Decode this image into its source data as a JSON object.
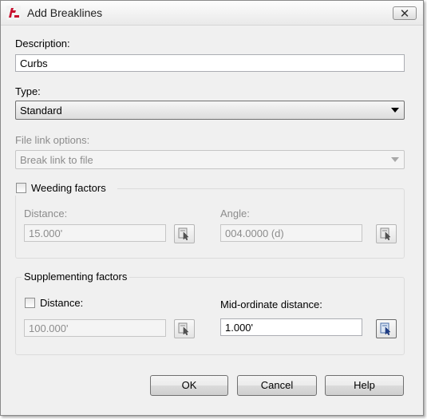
{
  "window": {
    "title": "Add Breaklines",
    "close_glyph": "✕"
  },
  "description": {
    "label": "Description:",
    "value": "Curbs"
  },
  "type": {
    "label": "Type:",
    "selected": "Standard"
  },
  "file_link": {
    "label": "File link options:",
    "selected": "Break link to file"
  },
  "weeding": {
    "label": "Weeding factors",
    "checked": false,
    "distance": {
      "label": "Distance:",
      "value": "15.000'"
    },
    "angle": {
      "label": "Angle:",
      "value": "004.0000 (d)"
    }
  },
  "supplementing": {
    "label": "Supplementing factors",
    "distance": {
      "label": "Distance:",
      "checked": false,
      "value": "100.000'"
    },
    "mid_ordinate": {
      "label": "Mid-ordinate distance:",
      "value": "1.000'"
    }
  },
  "buttons": {
    "ok": "OK",
    "cancel": "Cancel",
    "help": "Help"
  },
  "icons": {
    "app": "autocad-icon",
    "pick": "pick-from-drawing-icon"
  }
}
